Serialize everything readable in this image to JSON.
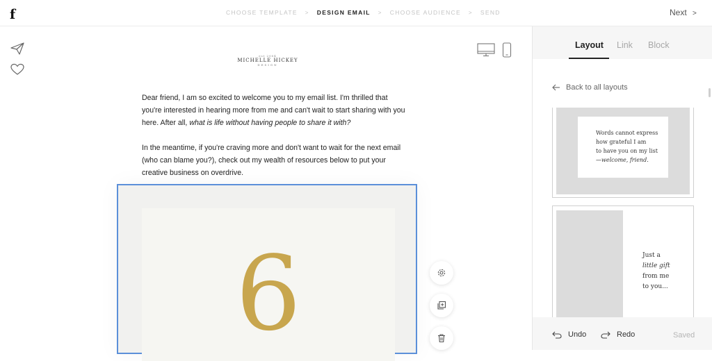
{
  "app": {
    "logo": "f"
  },
  "steps": [
    {
      "label": "CHOOSE TEMPLATE",
      "active": false
    },
    {
      "label": "DESIGN EMAIL",
      "active": true
    },
    {
      "label": "CHOOSE AUDIENCE",
      "active": false
    },
    {
      "label": "SEND",
      "active": false
    }
  ],
  "step_separator": ">",
  "next_label": "Next",
  "next_chevron": ">",
  "email": {
    "brand_small": "est 2004",
    "brand_name": "MICHELLE HICKEY",
    "brand_sub": "DESIGN",
    "p1_text": "Dear friend, I am so excited to welcome you to my email list. I'm thrilled that you're interested in hearing more from me and can't wait to start sharing with you here. After all, ",
    "p1_italic": "what is life without having people to share it with?",
    "p2_text": "In the meantime, if you're craving more and don't want to wait for the next email (who can blame you?), check out my wealth of resources below to put your creative business on overdrive.",
    "block_numeral": "6"
  },
  "panel": {
    "tabs": [
      "Layout",
      "Link",
      "Block"
    ],
    "active_tab": "Layout",
    "back_label": "Back to all layouts",
    "card1_lines": [
      "Words cannot express",
      "how grateful I am",
      "to have you on my list",
      "—welcome, friend."
    ],
    "card2_lines": [
      "Just a",
      "little gift",
      "from me",
      "to you..."
    ],
    "undo_label": "Undo",
    "redo_label": "Redo",
    "saved_label": "Saved"
  },
  "colors": {
    "accent": "#5b8fd9",
    "numeral": "#c8a64e"
  }
}
